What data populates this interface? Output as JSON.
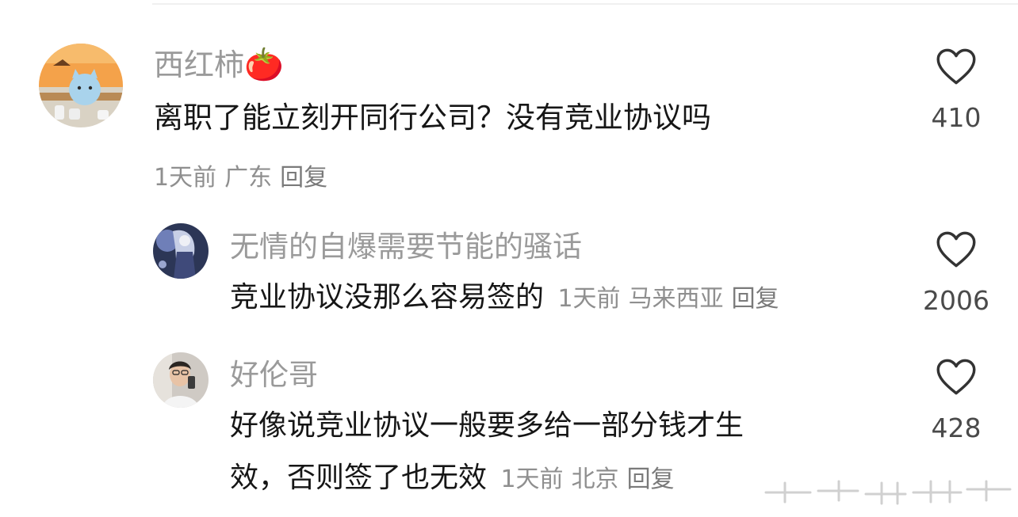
{
  "comments": [
    {
      "username": "西红柿",
      "emoji": "🍅",
      "text": "离职了能立刻开同行公司？没有竞业协议吗",
      "time": "1天前",
      "location": "广东",
      "reply_label": "回复",
      "likes": "410"
    }
  ],
  "replies": [
    {
      "username": "无情的自爆需要节能的骚话",
      "text": "竞业协议没那么容易签的",
      "time": "1天前",
      "location": "马来西亚",
      "reply_label": "回复",
      "likes": "2006"
    },
    {
      "username": "好伦哥",
      "text_line1": "好像说竞业协议一般要多给一部分钱才生",
      "text_line2": "效，否则签了也无效",
      "time": "1天前",
      "location": "北京",
      "reply_label": "回复",
      "likes": "428"
    }
  ],
  "icons": {
    "like": "heart-outline-icon"
  },
  "colors": {
    "name": "#9a9a9a",
    "text": "#161616",
    "meta": "#8f8f8f"
  }
}
